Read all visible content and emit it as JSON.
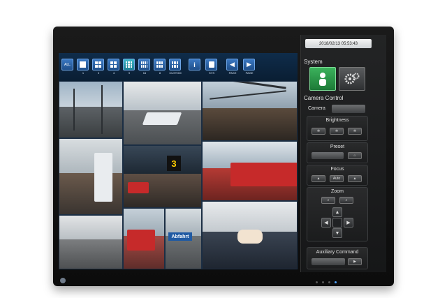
{
  "toolbar": {
    "buttons": [
      {
        "label": "ALL"
      },
      {
        "label": "1"
      },
      {
        "label": "3"
      },
      {
        "label": "4"
      },
      {
        "label": "9"
      },
      {
        "label": "16"
      },
      {
        "label": "8"
      },
      {
        "label": "CUSTOM"
      },
      {
        "label": ""
      },
      {
        "label": "SYS"
      },
      {
        "label": "PAGE"
      },
      {
        "label": "PAGE"
      }
    ]
  },
  "screen": {
    "platform_number": "3",
    "station_sign": "Abfahrt"
  },
  "panel": {
    "clock": "2018/02/13 05:53:43",
    "system_title": "System",
    "camera_control_title": "Camera Control",
    "camera_label": "Camera",
    "brightness_label": "Brightness",
    "preset_label": "Preset",
    "focus_label": "Focus",
    "focus_auto": "Auto",
    "zoom_label": "Zoom",
    "auxiliary_label": "Auxiliary Command"
  },
  "colors": {
    "accent_green": "#2e9a4e",
    "toolbar_blue": "#2d66aa",
    "train_red": "#c62a2a"
  }
}
